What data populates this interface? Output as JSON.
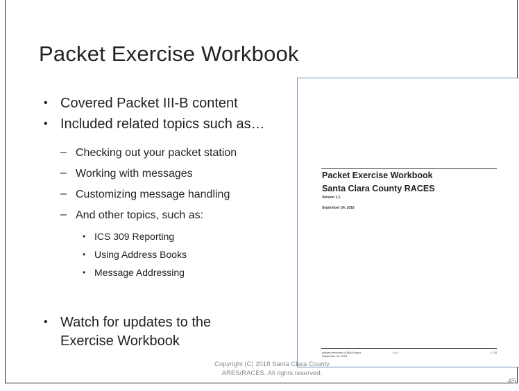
{
  "slide": {
    "title": "Packet Exercise Workbook",
    "bullets": [
      {
        "text": "Covered Packet III-B content",
        "level": 1
      },
      {
        "text": "Included related topics such as…",
        "level": 1
      },
      {
        "text": "Checking out your packet station",
        "level": 2
      },
      {
        "text": "Working with messages",
        "level": 2
      },
      {
        "text": "Customizing message handling",
        "level": 2
      },
      {
        "text": "And other topics, such as:",
        "level": 2
      },
      {
        "text": "ICS 309 Reporting",
        "level": 3
      },
      {
        "text": "Using Address Books",
        "level": 3
      },
      {
        "text": "Message Addressing",
        "level": 3
      },
      {
        "text": "Watch for updates to the",
        "level": 1
      },
      {
        "text": "Exercise Workbook",
        "level": 1
      }
    ],
    "copyright_line1": "Copyright (C) 2018 Santa Clara County",
    "copyright_line2": "ARES/RACES. All rights reserved.",
    "page_number": "45"
  },
  "document_preview": {
    "title": "Packet Exercise Workbook",
    "subtitle": "Santa Clara County RACES",
    "version": "Version 1.1",
    "date": "September 24, 2018",
    "footer_file": "packet-exercises-v180924.docx",
    "footer_date": "September 24, 2018",
    "footer_version": "v1.0",
    "footer_page": "1 / 25"
  }
}
